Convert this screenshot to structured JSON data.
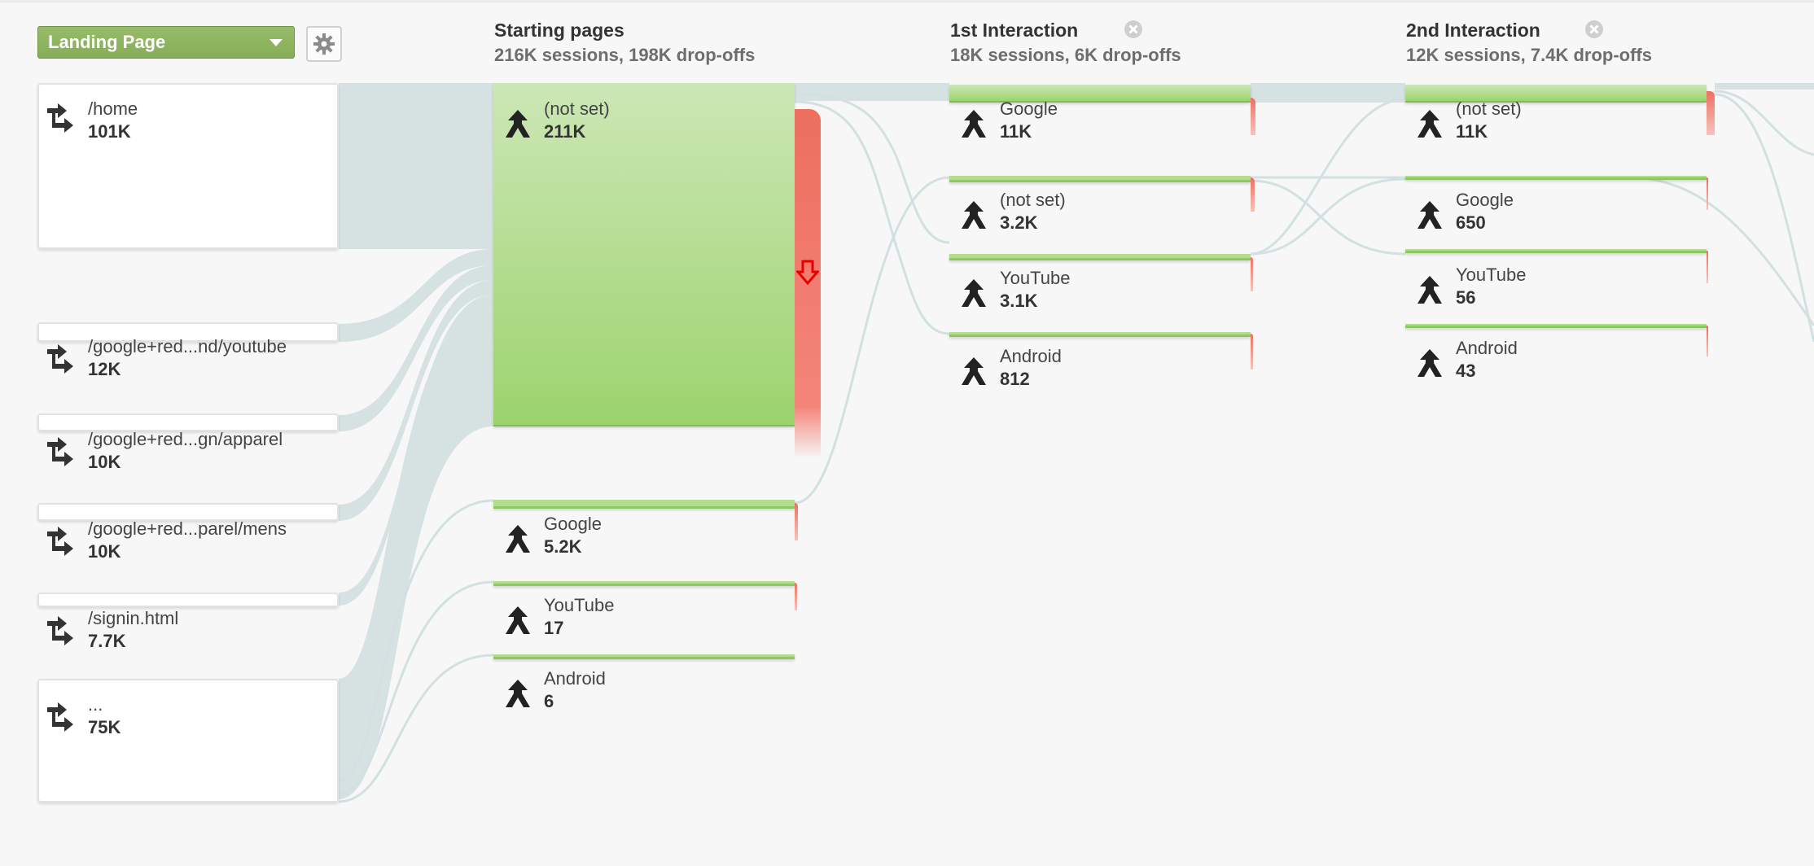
{
  "dimension_select": {
    "label": "Landing Page"
  },
  "columns": [
    {
      "title": "Starting pages",
      "subtitle": "216K sessions, 198K drop-offs"
    },
    {
      "title": "1st Interaction",
      "subtitle": "18K sessions, 6K drop-offs"
    },
    {
      "title": "2nd Interaction",
      "subtitle": "12K sessions, 7.4K drop-offs"
    }
  ],
  "sources": [
    {
      "name": "/home",
      "count": "101K"
    },
    {
      "name": "/google+red...nd/youtube",
      "count": "12K"
    },
    {
      "name": "/google+red...gn/apparel",
      "count": "10K"
    },
    {
      "name": "/google+red...parel/mens",
      "count": "10K"
    },
    {
      "name": "/signin.html",
      "count": "7.7K"
    },
    {
      "name": "...",
      "count": "75K"
    }
  ],
  "starting_pages": [
    {
      "name": "(not set)",
      "count": "211K"
    },
    {
      "name": "Google",
      "count": "5.2K"
    },
    {
      "name": "YouTube",
      "count": "17"
    },
    {
      "name": "Android",
      "count": "6"
    }
  ],
  "first_interaction": [
    {
      "name": "Google",
      "count": "11K"
    },
    {
      "name": "(not set)",
      "count": "3.2K"
    },
    {
      "name": "YouTube",
      "count": "3.1K"
    },
    {
      "name": "Android",
      "count": "812"
    }
  ],
  "second_interaction": [
    {
      "name": "(not set)",
      "count": "11K"
    },
    {
      "name": "Google",
      "count": "650"
    },
    {
      "name": "YouTube",
      "count": "56"
    },
    {
      "name": "Android",
      "count": "43"
    }
  ],
  "icons": {
    "source": "landing-arrow-icon",
    "node": "event-fork-icon",
    "settings": "gear-icon",
    "remove": "remove-step-icon",
    "dropoff": "dropoff-arrow-icon"
  },
  "colors": {
    "node_green": "#9cd36d",
    "dropoff_red": "#ec6f5f",
    "flow": "#d6e1e2",
    "select_green": "#8eb45f"
  }
}
